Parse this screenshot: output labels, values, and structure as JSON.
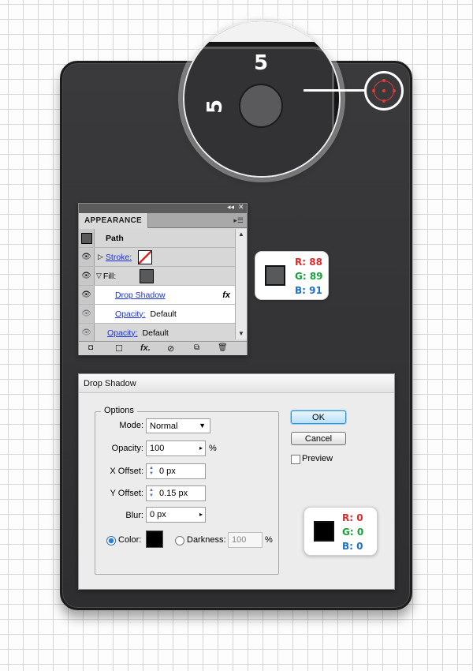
{
  "magnifier": {
    "label_top": "5",
    "label_left": "5"
  },
  "appearance_panel": {
    "topbar": {
      "collapse_label": "◂◂",
      "close_label": "✕"
    },
    "tab_label": "APPEARANCE",
    "menu_icon": "panel-menu-icon",
    "rows": {
      "path_label": "Path",
      "stroke_label": "Stroke:",
      "fill_label": "Fill:",
      "effect_label": "Drop Shadow",
      "effect_fx": "fx",
      "opacity1_label": "Opacity:",
      "opacity1_value": "Default",
      "opacity2_label": "Opacity:",
      "opacity2_value": "Default"
    },
    "fill_color": "#58595b",
    "footer_fx": "fx."
  },
  "fill_rgb": {
    "r": "R: 88",
    "g": "G: 89",
    "b": "B: 91",
    "color": "#58595b"
  },
  "shadow_rgb": {
    "r": "R: 0",
    "g": "G: 0",
    "b": "B: 0",
    "color": "#000000"
  },
  "drop_shadow": {
    "title": "Drop Shadow",
    "options_legend": "Options",
    "mode_label": "Mode:",
    "mode_value": "Normal",
    "opacity_label": "Opacity:",
    "opacity_value": "100",
    "opacity_unit": "%",
    "x_offset_label": "X Offset:",
    "x_offset_value": "0 px",
    "y_offset_label": "Y Offset:",
    "y_offset_value": "0.15 px",
    "blur_label": "Blur:",
    "blur_value": "0 px",
    "color_label": "Color:",
    "darkness_label": "Darkness:",
    "darkness_value": "100",
    "darkness_unit": "%",
    "ok_label": "OK",
    "cancel_label": "Cancel",
    "preview_label": "Preview",
    "shadow_color": "#000000"
  }
}
